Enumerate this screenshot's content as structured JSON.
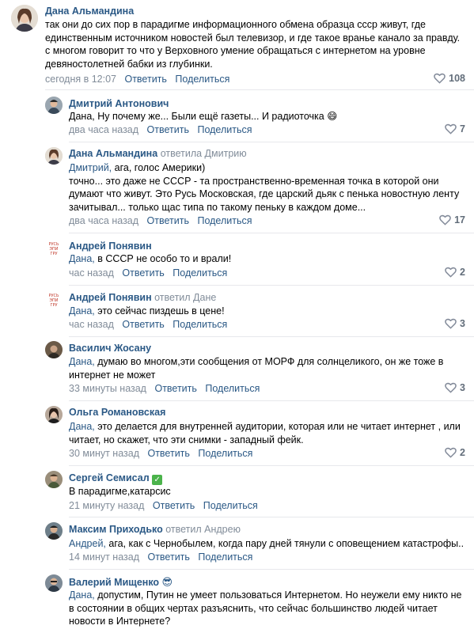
{
  "actions": {
    "reply_label": "Ответить",
    "share_label": "Поделиться"
  },
  "comments": [
    {
      "author": "Дана Альмандина",
      "reply_to": "",
      "addressee": "",
      "text": "так они до сих пор в парадигме информационного обмена образца ссср живут, где\nединственным источником новостей был телевизор, и где такое вранье канало за правду.\nс многом говорит то что у Верховного умение обращаться с интернетом на уровне\nдевяностолетней бабки из глубинки.",
      "time": "сегодня в 12:07",
      "likes": "108"
    },
    {
      "author": "Дмитрий Антонович",
      "reply_to": "",
      "addressee": "",
      "text": "Дана, Ну почему же... Были ещё газеты... И радиоточка 😄",
      "time": "два часа назад",
      "likes": "7"
    },
    {
      "author": "Дана Альмандина",
      "reply_to": "ответила Дмитрию",
      "addressee": "Дмитрий,",
      "text": " ага, голос Америки)\nточно... это даже не СССР - та пространственно-временная точка в которой они\nдумают что живут. Это Русь Московская, где царский дьяк с пенька новостную ленту\nзачитывал... только щас типа по такому пеньку в каждом доме...",
      "time": "два часа назад",
      "likes": "17"
    },
    {
      "author": "Андрей Понявин",
      "reply_to": "",
      "addressee": "Дана,",
      "text": " в СССР не особо то и врали!",
      "time": "час назад",
      "likes": "2"
    },
    {
      "author": "Андрей Понявин",
      "reply_to": "ответил Дане",
      "addressee": "Дана,",
      "text": " это сейчас пиздешь в цене!",
      "time": "час назад",
      "likes": "3"
    },
    {
      "author": "Василич Жосану",
      "reply_to": "",
      "addressee": "Дана,",
      "text": " думаю во многом,эти сообщения от МОРФ для солнцеликого, он же тоже в\nинтернет не может",
      "time": "33 минуты назад",
      "likes": "3"
    },
    {
      "author": "Ольга Романовская",
      "reply_to": "",
      "addressee": "Дана,",
      "text": " это делается для внутренней аудитории, которая или не читает интернет , или\nчитает, но скажет, что эти снимки - западный фейк.",
      "time": "30 минут назад",
      "likes": "2"
    },
    {
      "author": "Сергей Семисал",
      "reply_to": "",
      "addressee": "",
      "text": "В парадигме,катарсис",
      "time": "21 минуту назад",
      "likes": ""
    },
    {
      "author": "Максим Приходько",
      "reply_to": "ответил Андрею",
      "addressee": "Андрей,",
      "text": " ага, как с Чернобылем, когда пару дней тянули с оповещением катастрофы..",
      "time": "14 минут назад",
      "likes": ""
    },
    {
      "author": "Валерий Мищенко",
      "reply_to": "",
      "addressee": "Дана,",
      "text": " допустим, Путин не умеет пользоваться Интернетом. Но неужели ему никто не\nв состоянии в общих чертах разъяснить, что сейчас большинство людей читает\nновости в Интернете?",
      "time": "",
      "likes": ""
    }
  ],
  "emoji": {
    "semisal_badge": "✓",
    "mishchenko_badge": "😎"
  },
  "colors": {
    "link": "#2a5885",
    "meta": "#818c99",
    "divider": "#e7e8ec"
  }
}
